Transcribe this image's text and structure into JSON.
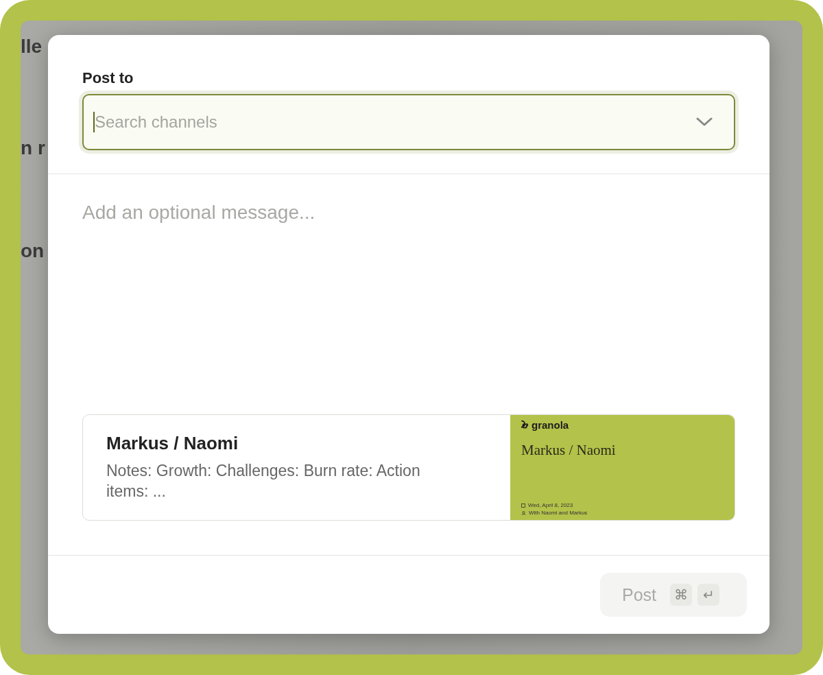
{
  "background_texts": [
    "lle",
    "n r",
    "on"
  ],
  "dialog": {
    "label": "Post to",
    "channel_search": {
      "placeholder": "Search channels"
    },
    "message": {
      "placeholder": "Add an optional message..."
    },
    "note_card": {
      "title": "Markus / Naomi",
      "summary": "Notes: Growth: Challenges: Burn rate: Action items: ...",
      "preview": {
        "brand": "granola",
        "title": "Markus / Naomi",
        "date": "Wed, April 8, 2023",
        "attendees": "With Naomi and Markus"
      }
    },
    "post_button": {
      "label": "Post",
      "disabled": true,
      "keys": [
        "⌘",
        "↵"
      ]
    }
  }
}
